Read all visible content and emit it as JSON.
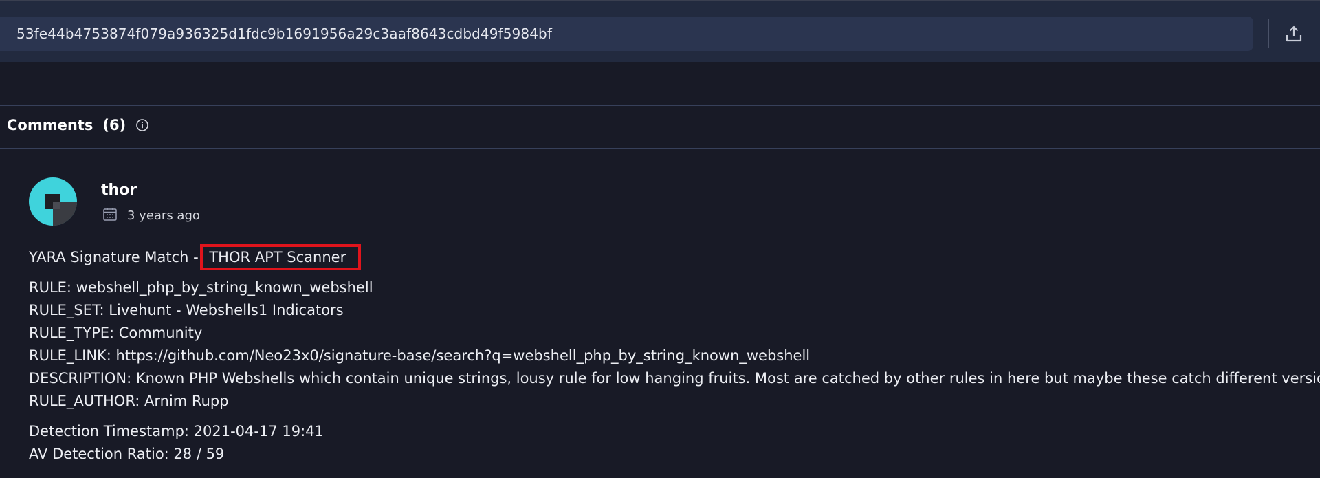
{
  "search": {
    "hash": "53fe44b4753874f079a936325d1fdc9b1691956a29c3aaf8643cdbd49f5984bf"
  },
  "toolbar": {
    "upload_icon": "upload-icon"
  },
  "comments": {
    "title": "Comments",
    "count": "(6)",
    "info_icon": "info-icon"
  },
  "comment": {
    "author": "thor",
    "date": "3 years ago",
    "avatar_colors": [
      "#3fd3dc",
      "#3a3c42",
      "#1e1f24"
    ],
    "line1_prefix": "YARA Signature Match - ",
    "line1_highlight": "THOR APT Scanner",
    "rule": "RULE: webshell_php_by_string_known_webshell",
    "rule_set": "RULE_SET: Livehunt - Webshells1 Indicators",
    "rule_type": "RULE_TYPE: Community",
    "rule_link": "RULE_LINK: https://github.com/Neo23x0/signature-base/search?q=webshell_php_by_string_known_webshell",
    "description": "DESCRIPTION: Known PHP Webshells which contain unique strings, lousy rule for low hanging fruits. Most are catched by other rules in here but maybe these catch different versions.",
    "rule_author": "RULE_AUTHOR: Arnim Rupp",
    "detection_timestamp": "Detection Timestamp: 2021-04-17 19:41",
    "av_ratio": "AV Detection Ratio: 28 / 59"
  },
  "colors": {
    "background": "#181a26",
    "topbar": "#222a3f",
    "search_box": "#2b3550",
    "highlight_border": "#e0141c"
  }
}
